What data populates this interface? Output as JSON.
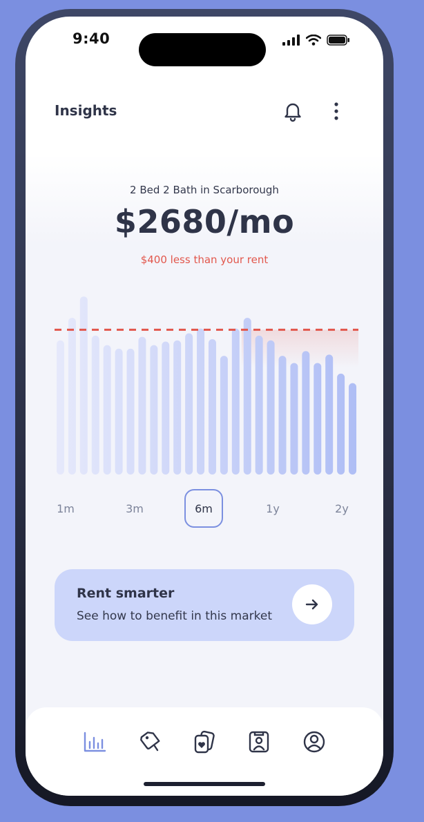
{
  "status_bar": {
    "time": "9:40"
  },
  "header": {
    "title": "Insights",
    "icons": [
      "bell-icon",
      "more-vertical-icon"
    ]
  },
  "listing": {
    "subtitle": "2 Bed 2 Bath in Scarborough",
    "price": "$2680/mo",
    "comparison": "$400 less than your rent"
  },
  "chart_data": {
    "type": "bar",
    "values": [
      2745,
      2840,
      2930,
      2765,
      2725,
      2710,
      2710,
      2760,
      2725,
      2740,
      2745,
      2775,
      2795,
      2750,
      2680,
      2795,
      2840,
      2765,
      2745,
      2680,
      2650,
      2700,
      2650,
      2685,
      2605,
      2565
    ],
    "reference_line": 2790,
    "ylim": [
      2180,
      2980
    ],
    "colors": {
      "bar_faded": "#e6e9fb",
      "bar_solid": "#aebdf5",
      "reference": "#e2574c"
    }
  },
  "range_selector": {
    "options": [
      "1m",
      "3m",
      "6m",
      "1y",
      "2y"
    ],
    "selected": "6m"
  },
  "cta": {
    "title": "Rent smarter",
    "subtitle": "See how to benefit in this market",
    "icon": "arrow-right-icon"
  },
  "tab_bar": {
    "tabs": [
      "bar-chart-icon",
      "tag-icon",
      "cards-heart-icon",
      "portrait-frame-icon",
      "user-circle-icon"
    ],
    "active": "bar-chart-icon"
  },
  "colors": {
    "accent": "#7b8fe0",
    "text": "#2f3448",
    "warning": "#e2574c",
    "card": "#ccd6fa"
  }
}
